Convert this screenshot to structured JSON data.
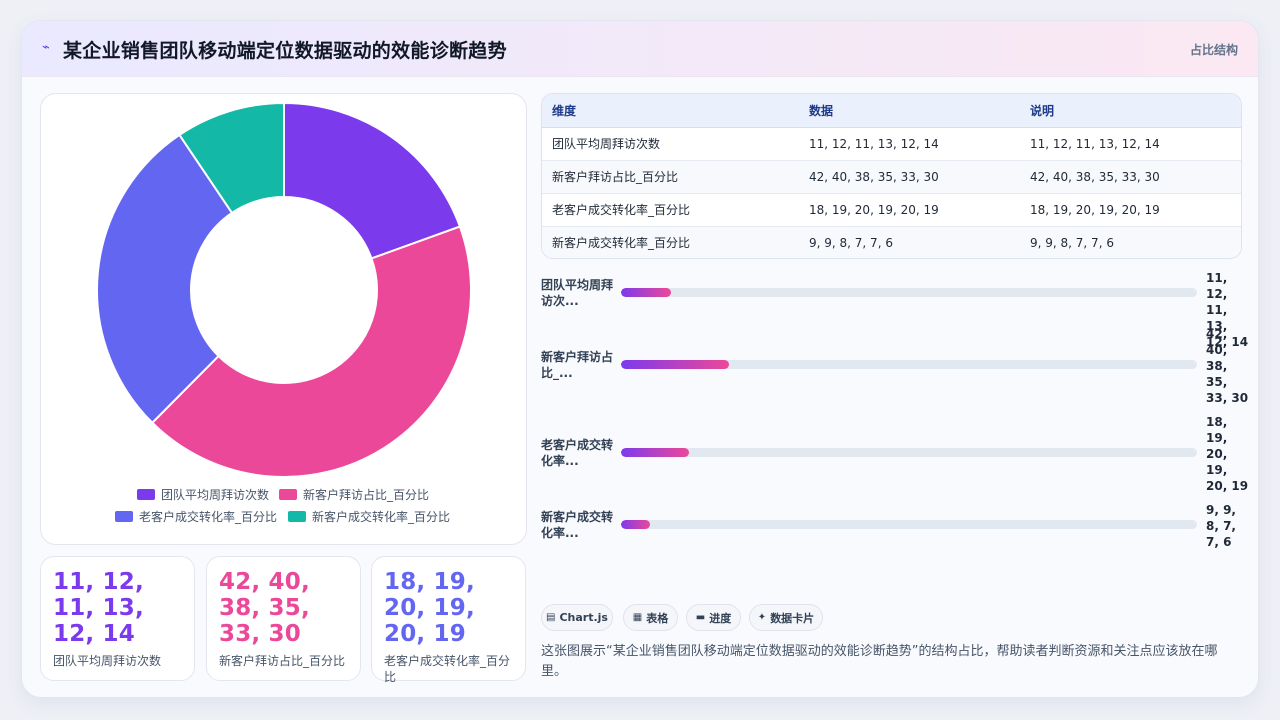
{
  "header": {
    "logo_icon": "sparkle-icon",
    "title": "某企业销售团队移动端定位数据驱动的效能诊断趋势",
    "tag": "占比结构"
  },
  "chart_data": {
    "type": "pie",
    "variant": "doughnut",
    "labels": [
      "团队平均周拜访次数",
      "新客户拜访占比_百分比",
      "老客户成交转化率_百分比",
      "新客户成交转化率_百分比"
    ],
    "values": [
      19.2,
      42.3,
      27.7,
      9.3
    ],
    "colors": [
      "#7c3aed",
      "#ec4899",
      "#6366f1",
      "#14b8a6"
    ],
    "legend_position": "bottom"
  },
  "stat_cards": [
    {
      "value": "11, 12, 11, 13, 12, 14",
      "label": "团队平均周拜访次数",
      "color": "#7c3aed"
    },
    {
      "value": "42, 40, 38, 35, 33, 30",
      "label": "新客户拜访占比_百分比",
      "color": "#ec4899"
    },
    {
      "value": "18, 19, 20, 19, 20, 19",
      "label": "老客户成交转化率_百分比",
      "color": "#6366f1"
    }
  ],
  "table": {
    "headers": [
      "维度",
      "数据",
      "说明"
    ],
    "rows": [
      [
        "团队平均周拜访次数",
        "11, 12, 11, 13, 12, 14",
        "11, 12, 11, 13, 12, 14"
      ],
      [
        "新客户拜访占比_百分比",
        "42, 40, 38, 35, 33, 30",
        "42, 40, 38, 35, 33, 30"
      ],
      [
        "老客户成交转化率_百分比",
        "18, 19, 20, 19, 20, 19",
        "18, 19, 20, 19, 20, 19"
      ],
      [
        "新客户成交转化率_百分比",
        "9, 9, 8, 7, 7, 6",
        "9, 9, 8, 7, 7, 6"
      ]
    ]
  },
  "progress": [
    {
      "label": "团队平均周拜访次数",
      "display_label": "团队平均周拜访次...",
      "value": "11, 12, 11, 13, 12, 14",
      "fill_fraction": 0.087
    },
    {
      "label": "新客户拜访占比_百分比",
      "display_label": "新客户拜访占比_...",
      "value": "42, 40, 38, 35, 33, 30",
      "fill_fraction": 0.188
    },
    {
      "label": "老客户成交转化率_百分比",
      "display_label": "老客户成交转化率...",
      "value": "18, 19, 20, 19, 20, 19",
      "fill_fraction": 0.118
    },
    {
      "label": "新客户成交转化率_百分比",
      "display_label": "新客户成交转化率...",
      "value": "9, 9, 8, 7, 7, 6",
      "fill_fraction": 0.05
    }
  ],
  "chips": [
    {
      "icon": "chart-icon",
      "glyph": "▤",
      "label": "Chart.js"
    },
    {
      "icon": "table-icon",
      "glyph": "▦",
      "label": "表格"
    },
    {
      "icon": "progress-icon",
      "glyph": "▬",
      "label": "进度"
    },
    {
      "icon": "card-icon",
      "glyph": "✦",
      "label": "数据卡片"
    }
  ],
  "description": "这张图展示“某企业销售团队移动端定位数据驱动的效能诊断趋势”的结构占比，帮助读者判断资源和关注点应该放在哪里。"
}
